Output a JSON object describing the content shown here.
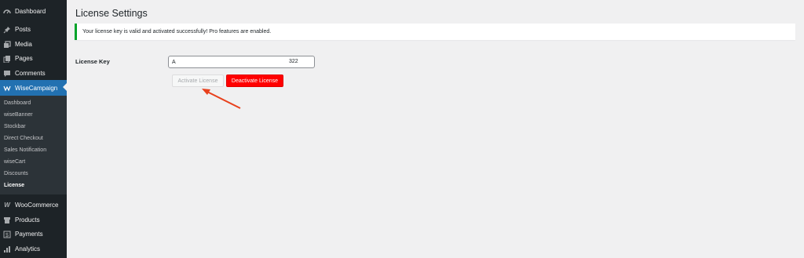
{
  "sidebar": {
    "dashboard": "Dashboard",
    "posts": "Posts",
    "media": "Media",
    "pages": "Pages",
    "comments": "Comments",
    "wisecampaign": "WiseCampaign",
    "submenu": [
      "Dashboard",
      "wiseBanner",
      "Stockbar",
      "Direct Checkout",
      "Sales Notification",
      "wiseCart",
      "Discounts",
      "License"
    ],
    "woocommerce": "WooCommerce",
    "products": "Products",
    "payments": "Payments",
    "analytics": "Analytics"
  },
  "main": {
    "title": "License Settings",
    "notice": "Your license key is valid and activated successfully! Pro features are enabled.",
    "license_label": "License Key",
    "license_value_start": "A",
    "license_value_end": "322",
    "activate_label": "Activate License",
    "deactivate_label": "Deactivate License"
  },
  "colors": {
    "sidebar_bg": "#1d2327",
    "submenu_bg": "#2c3338",
    "active_bg": "#2271b1",
    "notice_border": "#00a32a",
    "deactivate_bg": "#ff0000",
    "annotation_arrow": "#e8401c"
  },
  "icons": {
    "dashboard": "gauge-icon",
    "posts": "pushpin-icon",
    "media": "media-icon",
    "pages": "pages-icon",
    "comments": "speech-bubble-icon",
    "wisecampaign": "wisecampaign-icon",
    "woocommerce": "woo-icon",
    "products": "archive-box-icon",
    "payments": "dollar-icon",
    "analytics": "bar-chart-icon"
  }
}
